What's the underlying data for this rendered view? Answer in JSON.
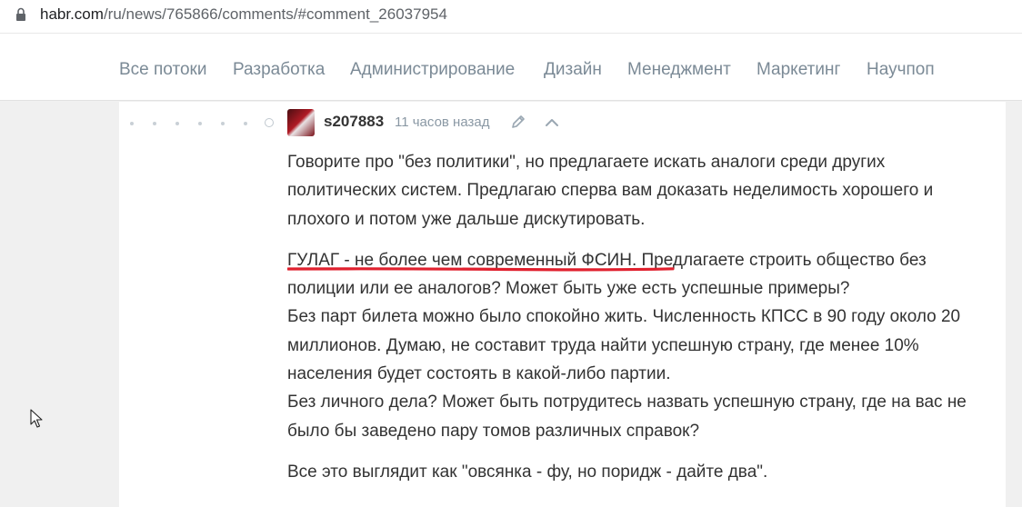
{
  "browser": {
    "url_domain": "habr.com",
    "url_path": "/ru/news/765866/comments/#comment_26037954"
  },
  "nav": {
    "items": [
      "Все потоки",
      "Разработка",
      "Администрирование",
      "Дизайн",
      "Менеджмент",
      "Маркетинг",
      "Научпоп"
    ]
  },
  "comment": {
    "author": "s207883",
    "time": "11 часов назад",
    "paragraphs": {
      "p1": "Говорите про \"без политики\", но предлагаете искать аналоги среди других политических систем. Предлагаю сперва вам доказать неделимость хорошего и плохого и потом уже дальше дискутировать.",
      "p2_highlight": "ГУЛАГ - не более чем современный ФСИН",
      "p2_rest": ". Предлагаете строить общество без полиции или ее аналогов? Может быть уже есть успешные примеры?",
      "p2_line2": "Без парт билета можно было спокойно жить. Численность КПСС в 90 году около 20 миллионов. Думаю, не составит труда найти успешную страну, где менее 10% населения будет состоять в какой-либо партии.",
      "p2_line3": "Без личного дела? Может быть потрудитесь назвать успешную страну, где на вас не было бы заведено пару томов различных справок?",
      "p3": "Все это выглядит как \"овсянка - фу, но поридж - дайте два\"."
    }
  },
  "colors": {
    "underline": "#e0202e",
    "nav_text": "#7b8a96",
    "body_text": "#333333"
  },
  "icons": {
    "lock": "lock-icon",
    "edit": "pencil-icon",
    "up": "chevron-up-icon",
    "cursor": "mouse-pointer-icon"
  }
}
